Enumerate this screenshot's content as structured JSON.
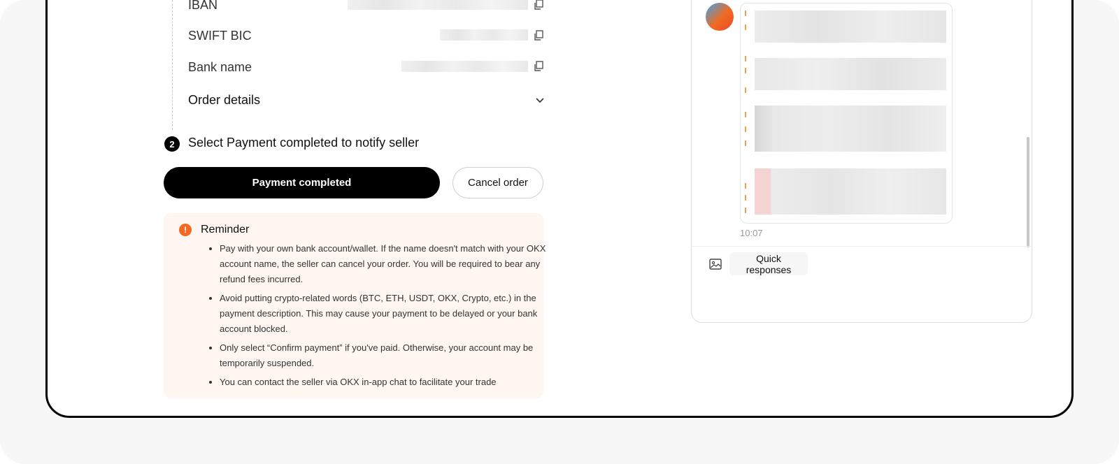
{
  "payment_details": {
    "rows": [
      {
        "label": "IBAN"
      },
      {
        "label": "SWIFT BIC"
      },
      {
        "label": "Bank name"
      }
    ],
    "order_details_label": "Order details"
  },
  "step2": {
    "number": "2",
    "text": "Select Payment completed to notify seller"
  },
  "actions": {
    "payment_completed": "Payment completed",
    "cancel_order": "Cancel order"
  },
  "reminder": {
    "icon_glyph": "!",
    "title": "Reminder",
    "items": [
      "Pay with your own bank account/wallet. If the name doesn't match with your OKX account name, the seller can cancel your order. You will be required to bear any refund fees incurred.",
      "Avoid putting crypto-related words (BTC, ETH, USDT, OKX, Crypto, etc.) in the payment description. This may cause your payment to be delayed or your bank account blocked.",
      "Only select “Confirm payment” if you've paid. Otherwise, your account may be temporarily suspended.",
      "You can contact the seller via OKX in-app chat to facilitate your trade"
    ],
    "accent_color": "#f26a21"
  },
  "chat": {
    "timestamp": "10:07",
    "quick_responses": "Quick responses",
    "icons": [
      "image-icon",
      "copy-icon",
      "chevron-down-icon"
    ]
  }
}
